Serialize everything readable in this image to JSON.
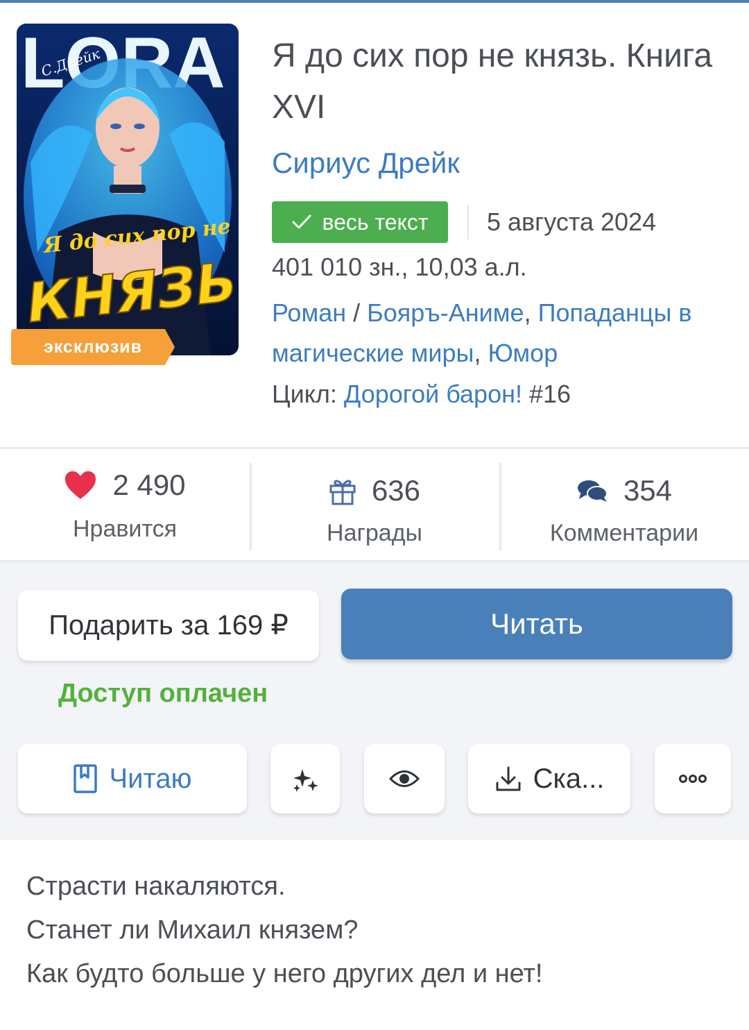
{
  "cover": {
    "series_logo": "LORA",
    "author_signature": "С.Дрейк",
    "title_line1": "Я до сих пор не",
    "title_line2": "КНЯЗЬ",
    "exclusive_badge": "эксклюзив"
  },
  "book": {
    "title": "Я до сих пор не князь. Книга XVI",
    "author": "Сириус Дрейк",
    "fulltext_badge": "весь текст",
    "date": "5 августа 2024",
    "size": "401 010 зн., 10,03 а.л.",
    "genres": {
      "genre1": "Роман",
      "sep1": " / ",
      "genre2": "Бояръ-Аниме",
      "sep2": ", ",
      "genre3": "Попаданцы в магические миры",
      "sep3": ", ",
      "genre4": "Юмор"
    },
    "cycle_label": "Цикл: ",
    "cycle_name": "Дорогой барон!",
    "cycle_number": " #16"
  },
  "stats": {
    "likes": {
      "count": "2 490",
      "label": "Нравится",
      "icon": "heart-icon"
    },
    "awards": {
      "count": "636",
      "label": "Награды",
      "icon": "gift-icon"
    },
    "comments": {
      "count": "354",
      "label": "Комментарии",
      "icon": "comments-icon"
    }
  },
  "actions": {
    "gift_label": "Подарить за 169 ₽",
    "read_label": "Читать",
    "access_status": "Доступ оплачен",
    "reading_label": "Читаю",
    "download_label": "Ска..."
  },
  "description": [
    "Страсти накаляются.",
    "Станет ли Михаил князем?",
    "Как будто больше у него других дел и нет!"
  ],
  "colors": {
    "accent_blue": "#3c7cc0",
    "button_blue": "#4a80b9",
    "success_green": "#4cae4f",
    "access_green": "#52b23a",
    "exclusive_orange": "#f5a03a",
    "heart_red": "#e8304a"
  }
}
